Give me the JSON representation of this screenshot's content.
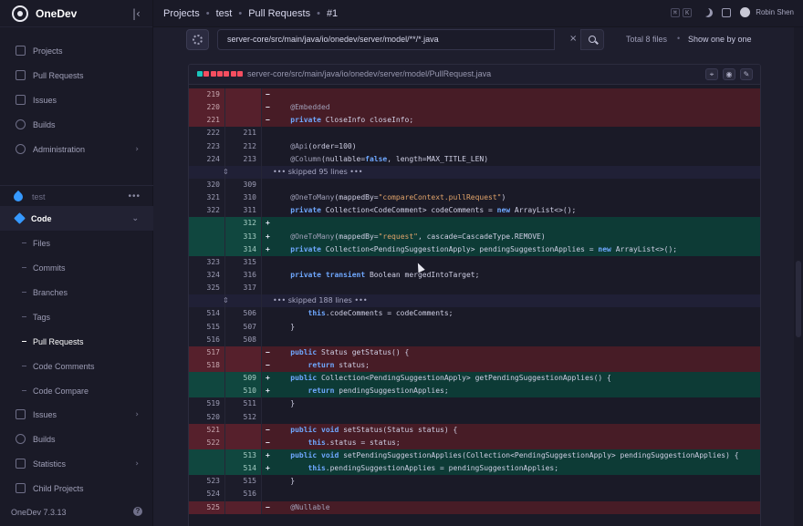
{
  "app": {
    "name": "OneDev",
    "version": "OneDev 7.3.13"
  },
  "sidebar": {
    "top_items": [
      {
        "label": "Projects",
        "icon": "projects-icon"
      },
      {
        "label": "Pull Requests",
        "icon": "pull-requests-icon"
      },
      {
        "label": "Issues",
        "icon": "issues-icon"
      },
      {
        "label": "Builds",
        "icon": "builds-icon"
      },
      {
        "label": "Administration",
        "icon": "administration-icon"
      }
    ],
    "project": {
      "name": "test",
      "menu": "•••"
    },
    "project_items": [
      {
        "label": "Code",
        "icon": "code-icon"
      },
      {
        "label": "Files"
      },
      {
        "label": "Commits"
      },
      {
        "label": "Branches"
      },
      {
        "label": "Tags"
      },
      {
        "label": "Pull Requests"
      },
      {
        "label": "Code Comments"
      },
      {
        "label": "Code Compare"
      },
      {
        "label": "Issues",
        "icon": "issues-icon"
      },
      {
        "label": "Builds",
        "icon": "builds-icon"
      },
      {
        "label": "Statistics",
        "icon": "statistics-icon"
      },
      {
        "label": "Child Projects",
        "icon": "child-projects-icon"
      }
    ],
    "help": "?"
  },
  "topbar": {
    "breadcrumbs": [
      "Projects",
      "test",
      "Pull Requests",
      "#1"
    ],
    "separator": "•",
    "kbd": [
      "⌘",
      "K"
    ],
    "user": "Robin Shen"
  },
  "filter": {
    "path": "server-core/src/main/java/io/onedev/server/model/**/*.java",
    "clear": "×",
    "total": "Total 8 files",
    "sep": "•",
    "show_one": "Show one by one"
  },
  "file": {
    "path": "server-core/src/main/java/io/onedev/server/model/PullRequest.java",
    "stat_colors": [
      "#1bc5bd",
      "#f64e60",
      "#f64e60",
      "#f64e60",
      "#f64e60",
      "#f64e60",
      "#f64e60"
    ]
  },
  "diff_lines": [
    {
      "type": "del",
      "old": "219",
      "new": "",
      "mark": "−",
      "code": ""
    },
    {
      "type": "del",
      "old": "220",
      "new": "",
      "mark": "−",
      "code": "    @Embedded"
    },
    {
      "type": "del",
      "old": "221",
      "new": "",
      "mark": "−",
      "code": "    private CloseInfo closeInfo;"
    },
    {
      "type": "ctx",
      "old": "222",
      "new": "211",
      "mark": "",
      "code": ""
    },
    {
      "type": "ctx",
      "old": "223",
      "new": "212",
      "mark": "",
      "code": "    @Api(order=100)"
    },
    {
      "type": "ctx",
      "old": "224",
      "new": "213",
      "mark": "",
      "code": "    @Column(nullable=false, length=MAX_TITLE_LEN)"
    },
    {
      "type": "skip",
      "old": "",
      "new": "",
      "mark": "",
      "code": "••• skipped 95 lines •••"
    },
    {
      "type": "ctx",
      "old": "320",
      "new": "309",
      "mark": "",
      "code": ""
    },
    {
      "type": "ctx",
      "old": "321",
      "new": "310",
      "mark": "",
      "code": "    @OneToMany(mappedBy=\"compareContext.pullRequest\")"
    },
    {
      "type": "ctx",
      "old": "322",
      "new": "311",
      "mark": "",
      "code": "    private Collection<CodeComment> codeComments = new ArrayList<>();"
    },
    {
      "type": "add",
      "old": "",
      "new": "312",
      "mark": "+",
      "code": ""
    },
    {
      "type": "add",
      "old": "",
      "new": "313",
      "mark": "+",
      "code": "    @OneToMany(mappedBy=\"request\", cascade=CascadeType.REMOVE)"
    },
    {
      "type": "add",
      "old": "",
      "new": "314",
      "mark": "+",
      "code": "    private Collection<PendingSuggestionApply> pendingSuggestionApplies = new ArrayList<>();"
    },
    {
      "type": "ctx",
      "old": "323",
      "new": "315",
      "mark": "",
      "code": ""
    },
    {
      "type": "ctx",
      "old": "324",
      "new": "316",
      "mark": "",
      "code": "    private transient Boolean mergedIntoTarget;"
    },
    {
      "type": "ctx",
      "old": "325",
      "new": "317",
      "mark": "",
      "code": ""
    },
    {
      "type": "skip",
      "old": "",
      "new": "",
      "mark": "",
      "code": "••• skipped 188 lines •••"
    },
    {
      "type": "ctx",
      "old": "514",
      "new": "506",
      "mark": "",
      "code": "        this.codeComments = codeComments;"
    },
    {
      "type": "ctx",
      "old": "515",
      "new": "507",
      "mark": "",
      "code": "    }"
    },
    {
      "type": "ctx",
      "old": "516",
      "new": "508",
      "mark": "",
      "code": ""
    },
    {
      "type": "del",
      "old": "517",
      "new": "",
      "mark": "−",
      "code": "    public Status getStatus() {"
    },
    {
      "type": "del",
      "old": "518",
      "new": "",
      "mark": "−",
      "code": "        return status;"
    },
    {
      "type": "add",
      "old": "",
      "new": "509",
      "mark": "+",
      "code": "    public Collection<PendingSuggestionApply> getPendingSuggestionApplies() {"
    },
    {
      "type": "add",
      "old": "",
      "new": "510",
      "mark": "+",
      "code": "        return pendingSuggestionApplies;"
    },
    {
      "type": "ctx",
      "old": "519",
      "new": "511",
      "mark": "",
      "code": "    }"
    },
    {
      "type": "ctx",
      "old": "520",
      "new": "512",
      "mark": "",
      "code": ""
    },
    {
      "type": "del",
      "old": "521",
      "new": "",
      "mark": "−",
      "code": "    public void setStatus(Status status) {"
    },
    {
      "type": "del",
      "old": "522",
      "new": "",
      "mark": "−",
      "code": "        this.status = status;"
    },
    {
      "type": "add",
      "old": "",
      "new": "513",
      "mark": "+",
      "code": "    public void setPendingSuggestionApplies(Collection<PendingSuggestionApply> pendingSuggestionApplies) {"
    },
    {
      "type": "add",
      "old": "",
      "new": "514",
      "mark": "+",
      "code": "        this.pendingSuggestionApplies = pendingSuggestionApplies;"
    },
    {
      "type": "ctx",
      "old": "523",
      "new": "515",
      "mark": "",
      "code": "    }"
    },
    {
      "type": "ctx",
      "old": "524",
      "new": "516",
      "mark": "",
      "code": ""
    },
    {
      "type": "del",
      "old": "525",
      "new": "",
      "mark": "−",
      "code": "    @Nullable"
    }
  ]
}
